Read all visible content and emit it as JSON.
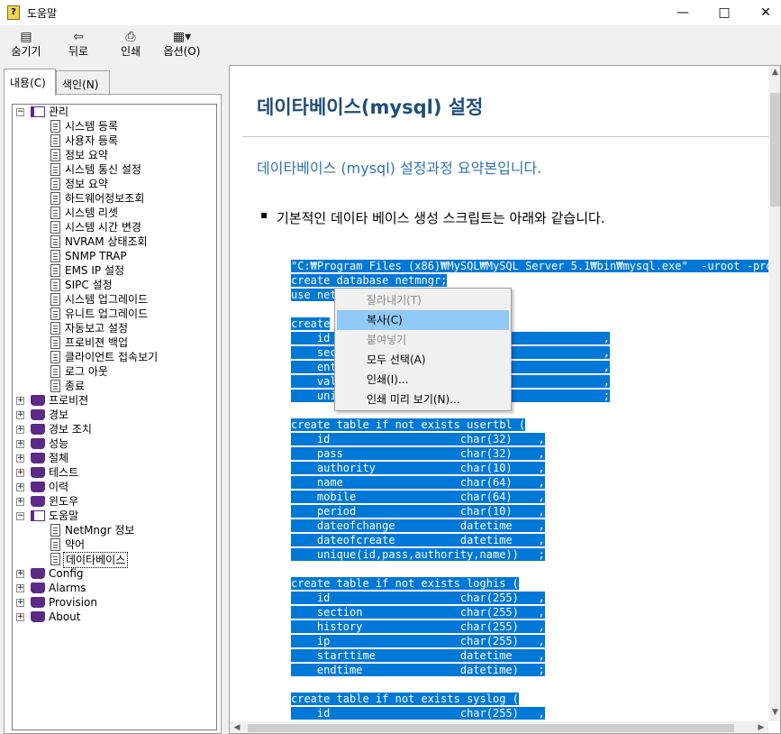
{
  "window": {
    "title": "도움말"
  },
  "toolbar": [
    {
      "label": "숨기기",
      "icon": "hide-icon"
    },
    {
      "label": "뒤로",
      "icon": "back-icon"
    },
    {
      "label": "인쇄",
      "icon": "print-icon"
    },
    {
      "label": "옵션(O)",
      "icon": "options-icon"
    }
  ],
  "tabs": {
    "contents": "내용(C)",
    "index": "색인(N)"
  },
  "tree": {
    "manage": "관리",
    "manage_children": [
      "시스템 등록",
      "사용자 등록",
      "정보 요약",
      "시스템 통신 설정",
      "정보 요약",
      "하드웨어정보조회",
      "시스템 리셋",
      "시스템 시간 변경",
      "NVRAM 상태조회",
      "SNMP TRAP",
      "EMS IP 설정",
      "SIPC 설정",
      "시스템 업그레이드",
      "유니트 업그레이드",
      "자동보고 설정",
      "프로비젼 백업",
      "클라이언트 접속보기",
      "로그 아웃",
      "종료"
    ],
    "mid_books": [
      "프로비젼",
      "경보",
      "경보 조치",
      "성능",
      "절체",
      "테스트",
      "이력",
      "윈도우"
    ],
    "help": "도움말",
    "help_children": [
      "NetMngr 정보",
      "약어",
      "데이타베이스"
    ],
    "bottom_books": [
      "Config",
      "Alarms",
      "Provision",
      "About"
    ]
  },
  "content": {
    "heading": "데이타베이스(mysql) 설정",
    "subtitle": "데이타베이스 (mysql) 설정과정 요약본입니다.",
    "bullet": "기본적인 데이타 베이스 생성 스크립트는 아래와 같습니다.",
    "code_blocks": [
      [
        "\"C:₩Program Files (x86)₩MySQL₩MySQL Server 5.1₩bin₩mysql.exe\"  -uroot -proot",
        "create database netmngr;",
        "use net"
      ],
      [
        "create",
        "    id                                          ,",
        "    sec                                         ,",
        "    ent                                         ,",
        "    val                                         ,",
        "    uni                                         ;"
      ],
      [
        "create table if not exists usertbl (",
        "    id                    char(32)    ,",
        "    pass                  char(32)    ,",
        "    authority             char(10)    ,",
        "    name                  char(64)    ,",
        "    mobile                char(64)    ,",
        "    period                char(10)    ,",
        "    dateofchange          datetime    ,",
        "    dateofcreate          datetime    ,",
        "    unique(id,pass,authority,name))   ;"
      ],
      [
        "create table if not exists loghis (",
        "    id                    char(255)   ,",
        "    section               char(255)   ,",
        "    history               char(255)   ,",
        "    ip                    char(255)   ,",
        "    starttime             datetime    ,",
        "    endtime               datetime)   ;"
      ],
      [
        "create table if not exists syslog (",
        "    id                    char(255)   ,"
      ]
    ]
  },
  "context_menu": [
    {
      "label": "잘라내기(T)",
      "enabled": false
    },
    {
      "label": "복사(C)",
      "enabled": true,
      "highlighted": true
    },
    {
      "label": "붙여넣기",
      "enabled": false
    },
    {
      "label": "모두 선택(A)",
      "enabled": true
    },
    {
      "label": "인쇄(I)...",
      "enabled": true
    },
    {
      "label": "인쇄 미리 보기(N)...",
      "enabled": true
    }
  ]
}
